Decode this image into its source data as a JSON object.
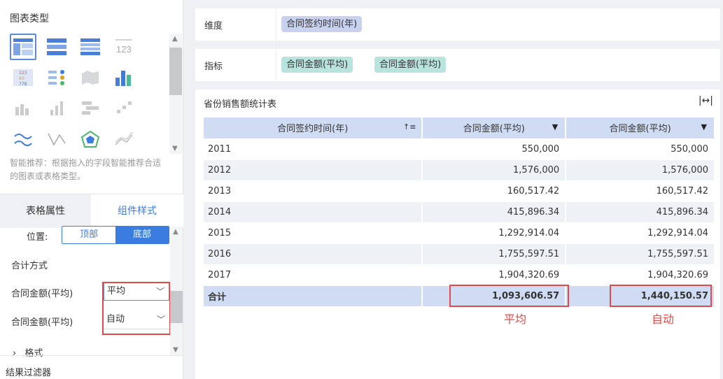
{
  "left_panel": {
    "chart_type_title": "图表类型",
    "chart_icons": [
      "table-icon",
      "cross-table-icon",
      "grouped-table-icon",
      "kpi-number-icon",
      "kpi-list-icon",
      "dot-kpi-icon",
      "map-icon",
      "histogram-icon",
      "bar-chart-icon",
      "column-chart-icon",
      "stacked-bar-icon",
      "step-chart-icon",
      "line-chart-icon",
      "scatter-line-icon",
      "radar-icon",
      "area-line-icon"
    ],
    "hint": "智能推荐：根据拖入的字段智能推荐合适的图表或表格类型。",
    "tabs": {
      "table_props": "表格属性",
      "component_style": "组件样式"
    },
    "position_label": "位置:",
    "position_options": {
      "top": "顶部",
      "bottom": "底部"
    },
    "sum_method_title": "合计方式",
    "sum_rows": [
      {
        "label": "合同金额(平均)",
        "value": "平均"
      },
      {
        "label": "合同金额(平均)",
        "value": "自动"
      }
    ],
    "format_label": "格式",
    "result_filter": "结果过滤器"
  },
  "shelves": {
    "dimension_label": "维度",
    "dimension_pill": "合同签约时间(年)",
    "measure_label": "指标",
    "measure_pills": [
      "合同金额(平均)",
      "合同金额(平均)"
    ]
  },
  "card": {
    "title": "省份销售额统计表",
    "headers": [
      "合同签约时间(年)",
      "合同金额(平均)",
      "合同金额(平均)"
    ],
    "rows": [
      [
        "2011",
        "550,000",
        "550,000"
      ],
      [
        "2012",
        "1,576,000",
        "1,576,000"
      ],
      [
        "2013",
        "160,517.42",
        "160,517.42"
      ],
      [
        "2014",
        "415,896.34",
        "415,896.34"
      ],
      [
        "2015",
        "1,292,914.04",
        "1,292,914.04"
      ],
      [
        "2016",
        "1,755,597.51",
        "1,755,597.51"
      ],
      [
        "2017",
        "1,904,320.69",
        "1,904,320.69"
      ]
    ],
    "total": [
      "合计",
      "1,093,606.57",
      "1,440,150.57"
    ],
    "annotations": [
      "平均",
      "自动"
    ]
  },
  "colors": {
    "accent": "#3b7ce0",
    "highlight": "#e24a4a",
    "header_bg": "#cfdcf3"
  }
}
